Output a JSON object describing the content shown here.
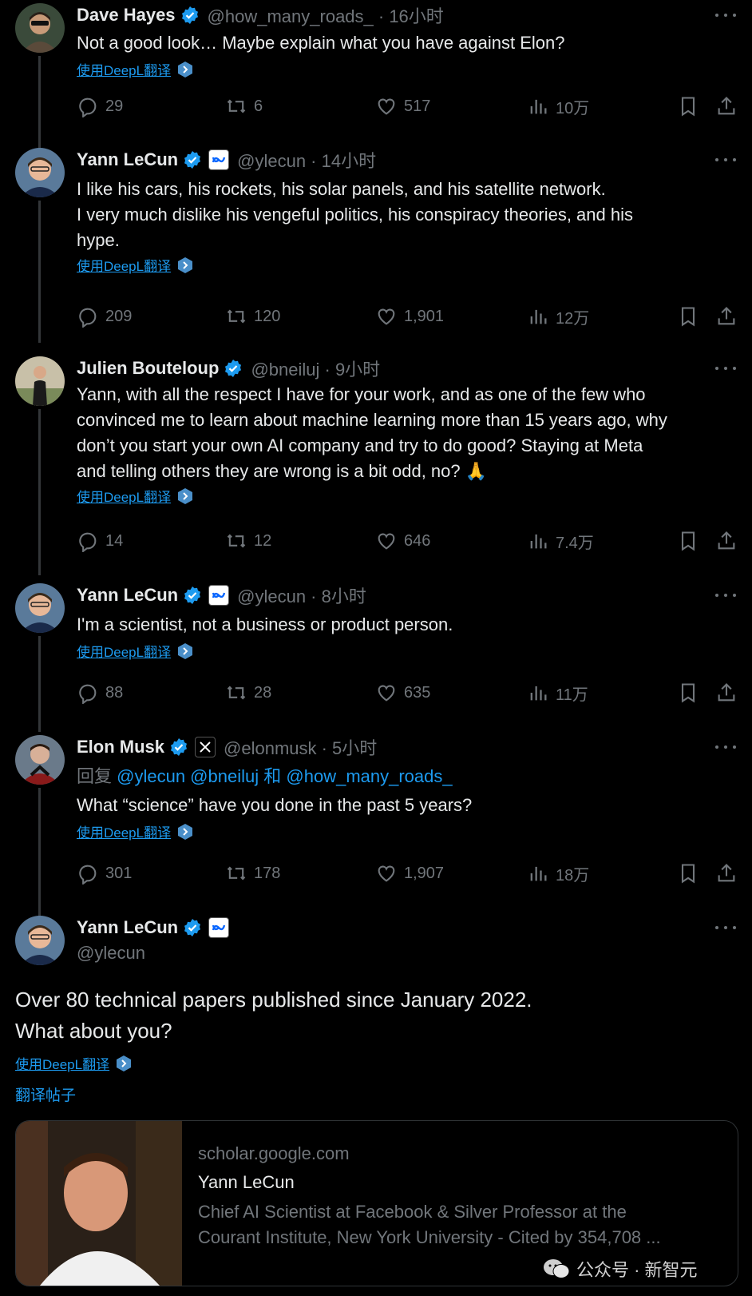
{
  "tweets": [
    {
      "name": "Dave Hayes",
      "handle": "@how_many_roads_ · 16小时",
      "text": [
        "Not a good look… Maybe explain what you have against Elon?"
      ],
      "translate": "使用DeepL翻译",
      "replies": "29",
      "retweets": "6",
      "likes": "517",
      "views": "10万"
    },
    {
      "name": "Yann LeCun",
      "handle": "@ylecun · 14小时",
      "text": [
        "I like his cars, his rockets, his solar panels, and his satellite network.",
        "I very much dislike his vengeful politics, his conspiracy theories, and his",
        "hype."
      ],
      "translate": "使用DeepL翻译",
      "replies": "209",
      "retweets": "120",
      "likes": "1,901",
      "views": "12万"
    },
    {
      "name": "Julien Bouteloup",
      "handle": "@bneiluj · 9小时",
      "text": [
        "Yann, with all the respect I have for your work, and as one of the few who",
        "convinced me to learn about machine learning more than 15 years ago, why",
        "don’t you start your own AI company and try to do good? Staying at Meta",
        "and telling others they are wrong is a bit odd, no? 🙏"
      ],
      "translate": "使用DeepL翻译",
      "replies": "14",
      "retweets": "12",
      "likes": "646",
      "views": "7.4万"
    },
    {
      "name": "Yann LeCun",
      "handle": "@ylecun · 8小时",
      "text": [
        "I'm a scientist, not a business or product person."
      ],
      "translate": "使用DeepL翻译",
      "replies": "88",
      "retweets": "28",
      "likes": "635",
      "views": "11万"
    },
    {
      "name": "Elon Musk",
      "handle": "@elonmusk · 5小时",
      "reply_prefix": "回复",
      "reply_mentions": "@ylecun @bneiluj",
      "reply_and": "和",
      "reply_last": "@how_many_roads_",
      "text": [
        "What “science” have you done in the past 5 years?"
      ],
      "translate": "使用DeepL翻译",
      "replies": "301",
      "retweets": "178",
      "likes": "1,907",
      "views": "18万"
    }
  ],
  "main": {
    "name": "Yann LeCun",
    "handle": "@ylecun",
    "text": [
      "Over 80 technical papers published since January 2022.",
      "What about you?"
    ],
    "translate": "使用DeepL翻译",
    "translate_post": "翻译帖子",
    "card": {
      "domain": "scholar.google.com",
      "title": "Yann LeCun",
      "desc": [
        "Chief AI Scientist at Facebook & Silver Professor at the",
        "Courant Institute, New York University - Cited by 354,708 ..."
      ]
    }
  },
  "watermark": "公众号 · 新智元",
  "colors": {
    "accent": "#1d9bf0",
    "muted": "#71767b",
    "text": "#e7e9ea",
    "bg": "#000000"
  }
}
